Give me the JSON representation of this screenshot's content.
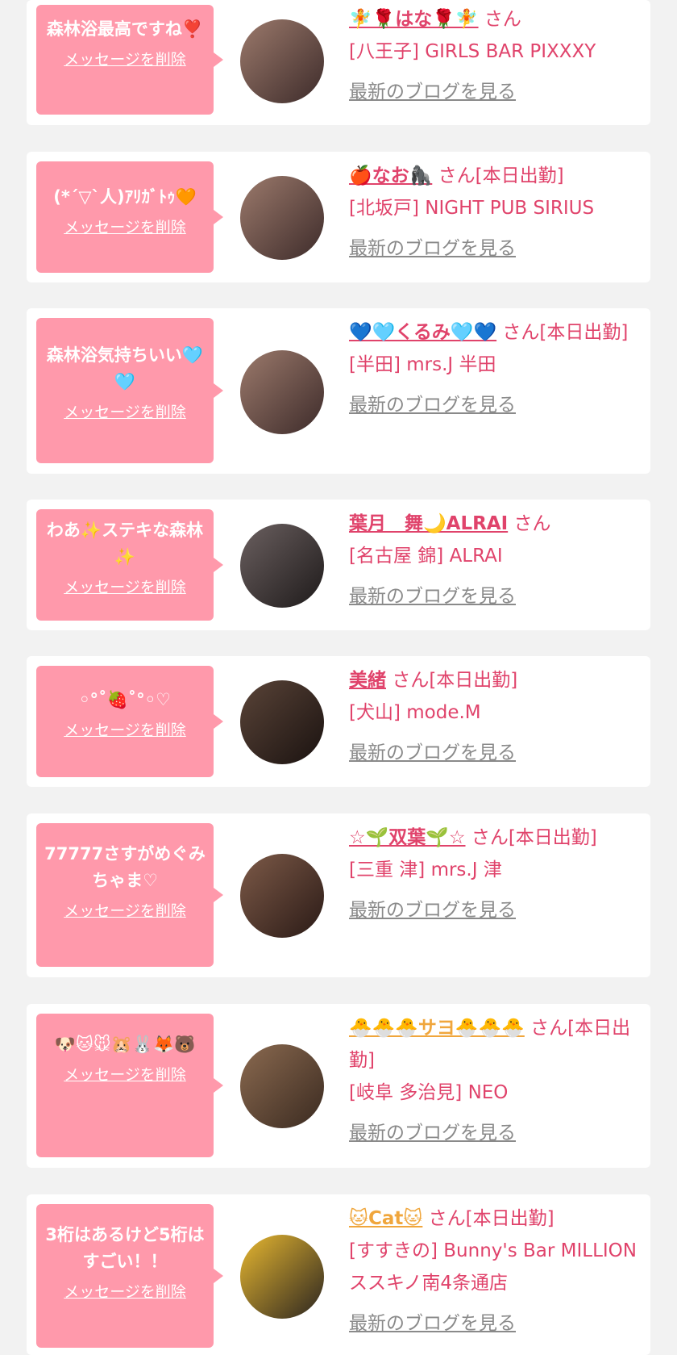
{
  "items": [
    {
      "message": "森林浴最高ですね❣️",
      "delete_label": "メッセージを削除",
      "name": "🧚🌹はな🌹🧚",
      "suffix": "さん",
      "shop": "[八王子] GIRLS BAR PIXXXY",
      "blog_label": "最新のブログを見る"
    },
    {
      "message": "(*´▽`人)ｱﾘｶﾞﾄｩ🧡",
      "delete_label": "メッセージを削除",
      "name": "🍎なお🦍",
      "suffix": "さん[本日出勤]",
      "shop": "[北坂戸] NIGHT PUB SIRIUS",
      "blog_label": "最新のブログを見る"
    },
    {
      "message": "森林浴気持ちいい🩵🩵",
      "delete_label": "メッセージを削除",
      "name": "💙🩵くるみ🩵💙",
      "suffix": "さん[本日出勤]",
      "shop": "[半田] mrs.J 半田",
      "blog_label": "最新のブログを見る"
    },
    {
      "message": "わあ✨ステキな森林✨",
      "delete_label": "メッセージを削除",
      "name": "葉月　舞🌙ALRAI",
      "suffix": "さん",
      "shop": "[名古屋 錦] ALRAI",
      "blog_label": "最新のブログを見る"
    },
    {
      "message": "◦°˚🍓˚°◦♡",
      "delete_label": "メッセージを削除",
      "name": "美緒",
      "suffix": "さん[本日出勤]",
      "shop": "[犬山] mode.M",
      "blog_label": "最新のブログを見る"
    },
    {
      "message": "77777さすがめぐみちゃま♡",
      "delete_label": "メッセージを削除",
      "name": "☆🌱双葉🌱☆",
      "suffix": "さん[本日出勤]",
      "shop": "[三重 津] mrs.J 津",
      "blog_label": "最新のブログを見る"
    },
    {
      "message": "🐶🐱🐭🐹🐰🦊🐻",
      "delete_label": "メッセージを削除",
      "name": "🐣🐣🐣サヨ🐣🐣🐣",
      "suffix": "さん[本日出勤]",
      "shop": "[岐阜 多治見] NEO",
      "blog_label": "最新のブログを見る"
    },
    {
      "message": "3桁はあるけど5桁はすごい！！",
      "delete_label": "メッセージを削除",
      "name": "🐱Cat🐱",
      "suffix": "さん[本日出勤]",
      "shop": "[すすきの] Bunny's Bar MILLION ススキノ南4条通店",
      "blog_label": "最新のブログを見る"
    }
  ]
}
